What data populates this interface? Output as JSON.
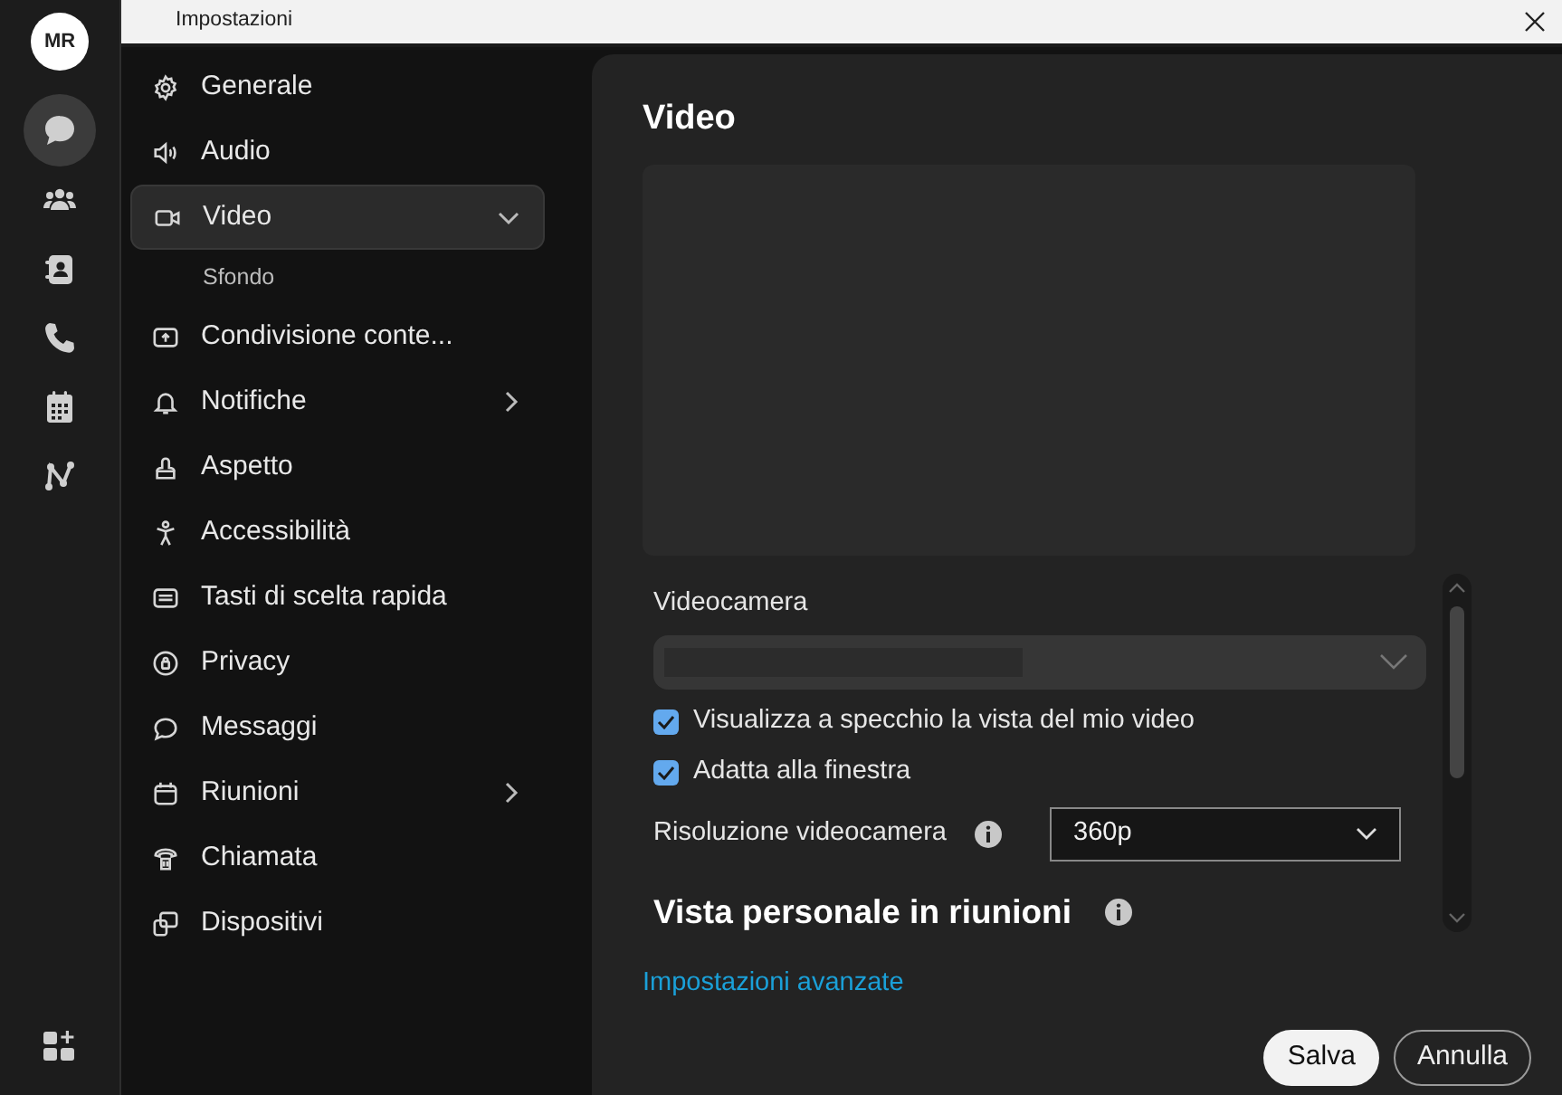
{
  "window": {
    "title": "Impostazioni"
  },
  "rail": {
    "avatar": "MR",
    "items": [
      {
        "selected": true
      },
      {
        "selected": false
      },
      {
        "selected": false
      },
      {
        "selected": false
      },
      {
        "selected": false
      },
      {
        "selected": false
      }
    ]
  },
  "nav": [
    {
      "label": "Generale",
      "kind": "page",
      "selected": false
    },
    {
      "label": "Audio",
      "kind": "page",
      "selected": false
    },
    {
      "label": "Video",
      "kind": "group",
      "selected": true,
      "expanded": true,
      "children": [
        {
          "label": "Sfondo",
          "selected": false
        }
      ]
    },
    {
      "label": "Condivisione conte...",
      "kind": "page",
      "selected": false
    },
    {
      "label": "Notifiche",
      "kind": "group",
      "selected": false,
      "expanded": false
    },
    {
      "label": "Aspetto",
      "kind": "page",
      "selected": false
    },
    {
      "label": "Accessibilità",
      "kind": "page",
      "selected": false
    },
    {
      "label": "Tasti di scelta rapida",
      "kind": "page",
      "selected": false
    },
    {
      "label": "Privacy",
      "kind": "page",
      "selected": false
    },
    {
      "label": "Messaggi",
      "kind": "page",
      "selected": false
    },
    {
      "label": "Riunioni",
      "kind": "group",
      "selected": false,
      "expanded": false
    },
    {
      "label": "Chiamata",
      "kind": "page",
      "selected": false
    },
    {
      "label": "Dispositivi",
      "kind": "page",
      "selected": false
    }
  ],
  "panel": {
    "heading": "Video",
    "camera": {
      "label": "Videocamera"
    },
    "checkboxes": [
      {
        "label": "Visualizza a specchio la vista del mio video",
        "checked": true
      },
      {
        "label": "Adatta alla finestra",
        "checked": true
      }
    ],
    "resolution": {
      "label": "Risoluzione videocamera",
      "value": "360p"
    },
    "section_heading": "Vista personale in riunioni",
    "link": "Impostazioni avanzate"
  },
  "buttons": [
    {
      "label": "Salva",
      "kind": "primary"
    },
    {
      "label": "Annulla",
      "kind": "secondary"
    }
  ]
}
